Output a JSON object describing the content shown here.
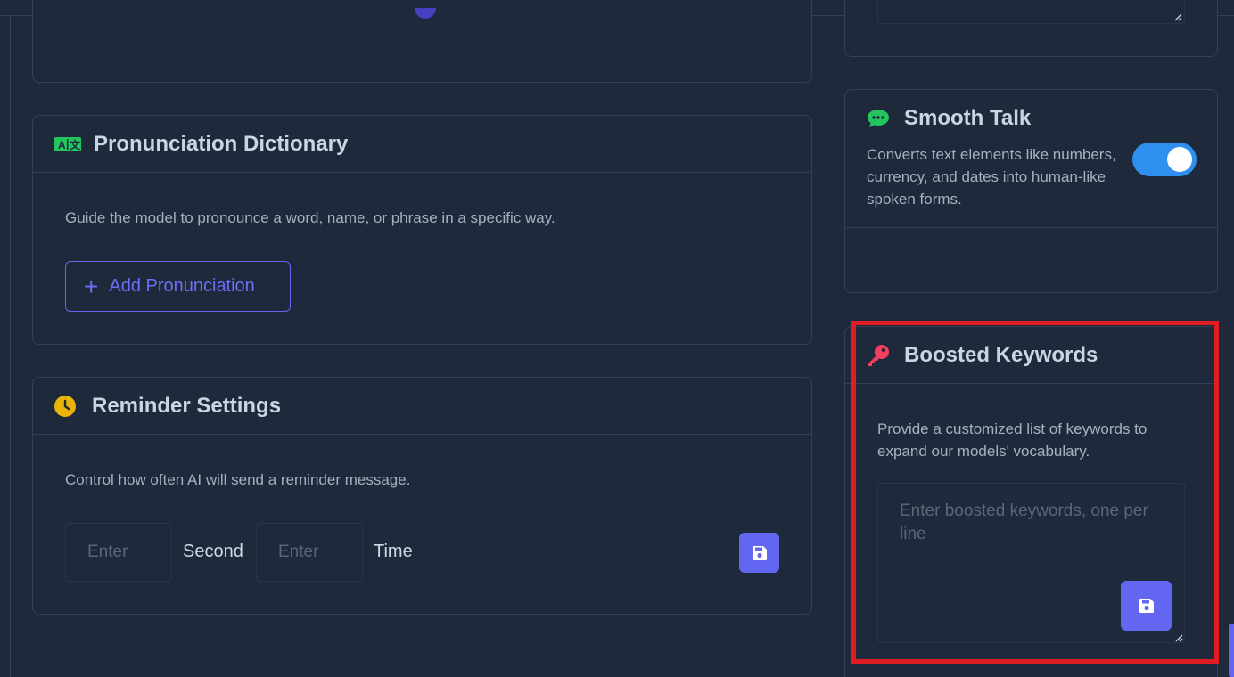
{
  "pronunciation": {
    "title": "Pronunciation Dictionary",
    "description": "Guide the model to pronounce a word, name, or phrase in a specific way.",
    "add_button_label": "Add Pronunciation"
  },
  "reminder": {
    "title": "Reminder Settings",
    "description": "Control how often AI will send a reminder message.",
    "interval_placeholder": "Enter",
    "interval_unit": "Second",
    "count_placeholder": "Enter",
    "count_unit": "Time"
  },
  "smooth_talk": {
    "title": "Smooth Talk",
    "description": "Converts text elements like numbers, currency, and dates into human-like spoken forms.",
    "enabled": true
  },
  "boosted_keywords": {
    "title": "Boosted Keywords",
    "description": "Provide a customized list of keywords to expand our models' vocabulary.",
    "placeholder": "Enter boosted keywords, one per line"
  },
  "icons": {
    "pronunciation": "translate-icon",
    "reminder": "clock-icon",
    "smooth_talk": "chat-bubble-icon",
    "keywords": "key-icon",
    "save": "floppy-disk-icon"
  },
  "colors": {
    "background": "#1e293b",
    "accent": "#6366f1",
    "toggle_on": "#2e8ff0",
    "highlight": "#e11d24",
    "icon_green": "#22c55e",
    "icon_yellow": "#eab308",
    "icon_pink": "#f43f5e"
  }
}
